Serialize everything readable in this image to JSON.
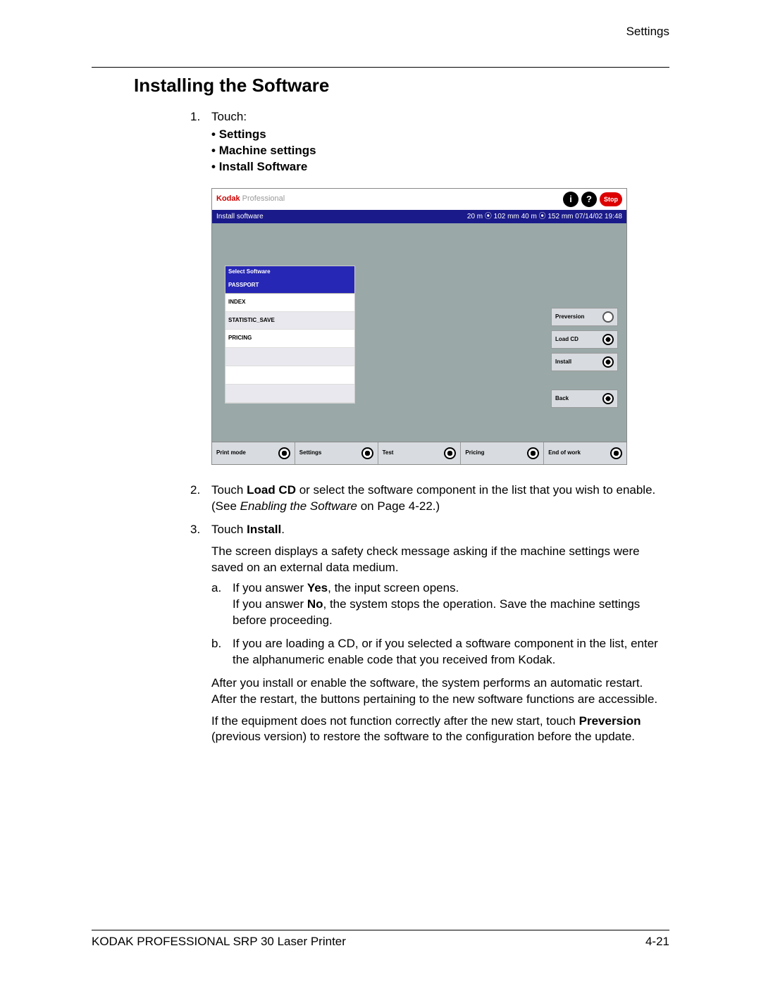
{
  "header": {
    "right": "Settings"
  },
  "title": "Installing the Software",
  "steps": {
    "s1": {
      "num": "1.",
      "lead": "Touch:",
      "bullets": [
        "Settings",
        "Machine settings",
        "Install Software"
      ]
    },
    "s2": {
      "num": "2.",
      "text_a": "Touch ",
      "bold_a": "Load CD",
      "text_b": " or select the software component in the list that you wish to enable. (See ",
      "ital": "Enabling the Software",
      "text_c": " on Page 4-22.)"
    },
    "s3": {
      "num": "3.",
      "text_a": "Touch ",
      "bold_a": "Install",
      "text_b": ".",
      "para1": "The screen displays a safety check message asking if the machine settings were saved on an external data medium.",
      "a": {
        "let": "a.",
        "line1_a": "If you answer ",
        "line1_bold": "Yes",
        "line1_b": ", the input screen opens.",
        "line2_a": "If you answer ",
        "line2_bold": "No",
        "line2_b": ", the system stops the operation. Save the machine settings before proceeding."
      },
      "b": {
        "let": "b.",
        "text": "If you are loading a CD, or if you selected a software component in the list, enter the alphanumeric enable code that you received from Kodak."
      },
      "para2": "After you install or enable the software, the system performs an automatic restart. After the restart, the buttons pertaining to the new software functions are accessible.",
      "para3_a": "If the equipment does not function correctly after the new start, touch ",
      "para3_bold": "Preversion",
      "para3_b": " (previous version) to restore the software to the configuration before the update."
    }
  },
  "device": {
    "brand_bold": "Kodak",
    "brand_rest": " Professional",
    "stop": "Stop",
    "titlebar_left": "Install software",
    "titlebar_right": "20 m ⦿ 102 mm   40 m ⦿ 152 mm  07/14/02      19:48",
    "panel_head": "Select Software",
    "panel_sel": "PASSPORT",
    "rows": [
      "INDEX",
      "STATISTIC_SAVE",
      "PRICING"
    ],
    "side": {
      "prev": "Preversion",
      "load": "Load CD",
      "install": "Install",
      "back": "Back"
    },
    "bottom": [
      "Print mode",
      "Settings",
      "Test",
      "Pricing",
      "End of work"
    ]
  },
  "footer": {
    "left": "KODAK PROFESSIONAL SRP 30 Laser Printer",
    "right": "4-21"
  }
}
